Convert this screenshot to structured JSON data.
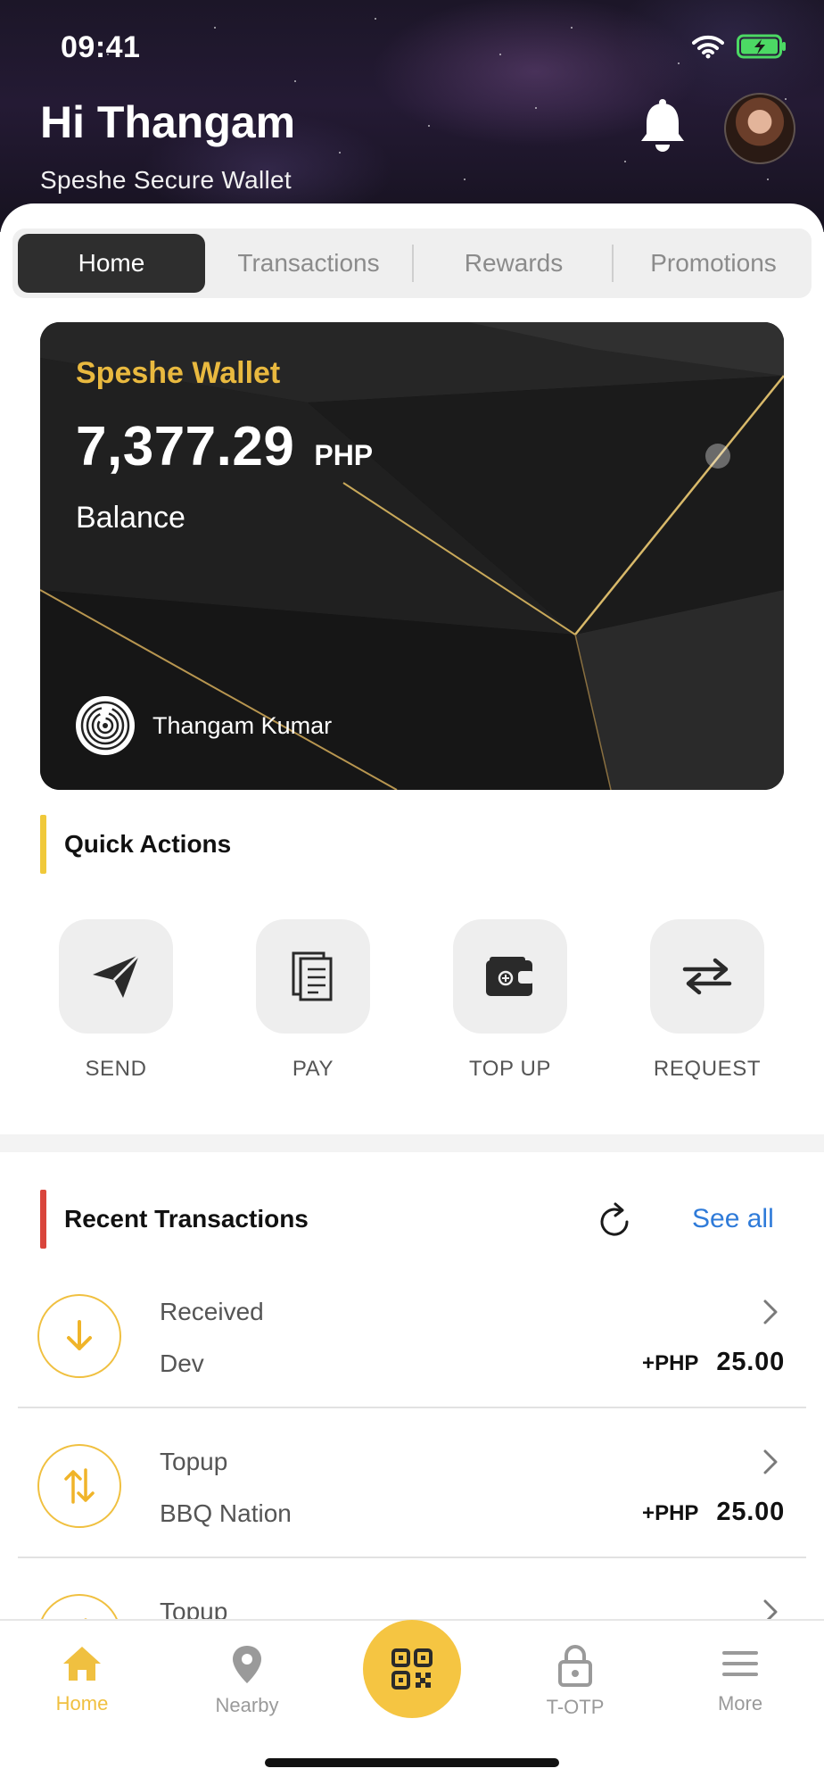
{
  "status_bar": {
    "time": "09:41"
  },
  "header": {
    "greeting": "Hi Thangam",
    "subtitle": "Speshe Secure Wallet"
  },
  "tabs": [
    {
      "label": "Home",
      "active": true
    },
    {
      "label": "Transactions",
      "active": false
    },
    {
      "label": "Rewards",
      "active": false
    },
    {
      "label": "Promotions",
      "active": false
    }
  ],
  "wallet_card": {
    "title": "Speshe Wallet",
    "amount": "7,377.29",
    "currency": "PHP",
    "balance_label": "Balance",
    "holder_name": "Thangam Kumar"
  },
  "quick_actions": {
    "title": "Quick Actions",
    "items": [
      {
        "label": "SEND",
        "icon": "send-icon"
      },
      {
        "label": "PAY",
        "icon": "document-icon"
      },
      {
        "label": "TOP UP",
        "icon": "wallet-icon"
      },
      {
        "label": "REQUEST",
        "icon": "exchange-icon"
      }
    ]
  },
  "recent_transactions": {
    "title": "Recent Transactions",
    "see_all": "See all",
    "items": [
      {
        "type": "Received",
        "party": "Dev",
        "currency": "+PHP",
        "amount": "25.00",
        "icon": "arrow-down-icon"
      },
      {
        "type": "Topup",
        "party": "BBQ Nation",
        "currency": "+PHP",
        "amount": "25.00",
        "icon": "arrows-updown-icon"
      },
      {
        "type": "Topup",
        "party": "",
        "currency": "",
        "amount": "",
        "icon": "arrows-updown-icon"
      }
    ]
  },
  "bottom_nav": {
    "items": [
      {
        "label": "Home",
        "active": true
      },
      {
        "label": "Nearby",
        "active": false
      },
      {
        "label": "T-OTP",
        "active": false
      },
      {
        "label": "More",
        "active": false
      }
    ]
  },
  "colors": {
    "accent_yellow": "#f5c542",
    "gold_text": "#e9b93f",
    "link_blue": "#2f7bd9",
    "quick_actions_bar": "#f0c93a",
    "transactions_bar": "#d9453c"
  }
}
